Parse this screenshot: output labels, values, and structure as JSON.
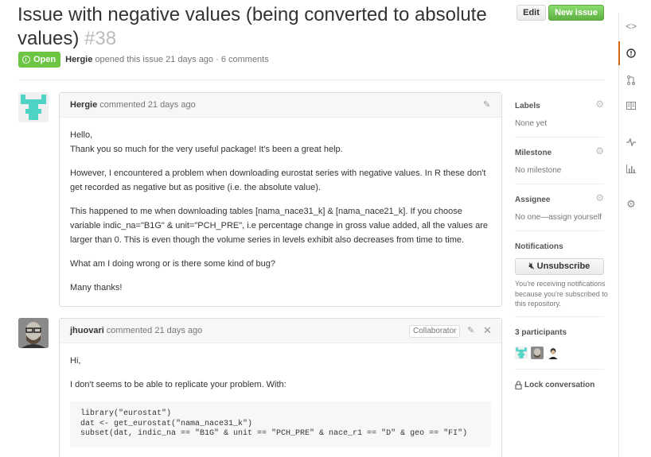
{
  "header": {
    "title": "Issue with negative values (being converted to absolute values)",
    "number": "#38",
    "edit_label": "Edit",
    "new_issue_label": "New issue"
  },
  "meta": {
    "state": "Open",
    "author": "Hergie",
    "text": "opened this issue 21 days ago · 6 comments"
  },
  "comments": [
    {
      "author": "Hergie",
      "time": "commented 21 days ago",
      "paragraphs": [
        "Hello,\nThank you so much for the very useful package! It's been a great help.",
        "However, I encountered a problem when downloading eurostat series with negative values. In R these don't get recorded as negative but as positive (i.e. the absolute value).",
        "This happened to me when downloading tables [nama_nace31_k] & [nama_nace21_k]. If you choose variable indic_na=\"B1G\" & unit=\"PCH_PRE\", i.e percentage change in gross value added, all the values are larger than 0. This is even though the volume series in levels exhibit also decreases from time to time.",
        "What am I doing wrong or is there some kind of bug?",
        "Many thanks!"
      ]
    },
    {
      "author": "jhuovari",
      "time": "commented 21 days ago",
      "badge": "Collaborator",
      "paragraphs": [
        "Hi,",
        "I don't seems to be able to replicate your problem. With:"
      ],
      "code": "library(\"eurostat\")\ndat <- get_eurostat(\"nama_nace31_k\")\nsubset(dat, indic_na == \"B1G\" & unit == \"PCH_PRE\" & nace_r1 == \"D\" & geo == \"FI\")"
    }
  ],
  "sidebar": {
    "labels_title": "Labels",
    "labels_value": "None yet",
    "milestone_title": "Milestone",
    "milestone_value": "No milestone",
    "assignee_title": "Assignee",
    "assignee_value": "No one—assign yourself",
    "notifications_title": "Notifications",
    "unsubscribe_label": "Unsubscribe",
    "notifications_note": "You're receiving notifications because you're subscribed to this repository.",
    "participants_title": "3 participants",
    "lock_label": "Lock conversation"
  },
  "nav_icons": [
    "code-icon",
    "issues-icon",
    "pull-request-icon",
    "wiki-icon",
    "pulse-icon",
    "graphs-icon",
    "settings-icon"
  ],
  "colors": {
    "open_green": "#6cc644",
    "new_issue_green": "#60b044",
    "active_nav": "#d26911"
  }
}
